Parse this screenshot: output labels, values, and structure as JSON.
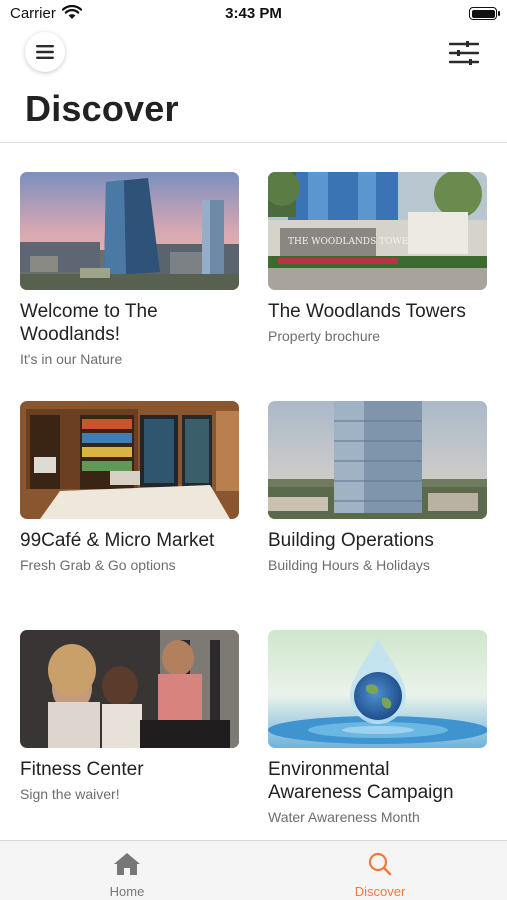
{
  "status_bar": {
    "carrier": "Carrier",
    "time": "3:43 PM"
  },
  "header": {
    "title": "Discover",
    "menu_icon": "hamburger-icon",
    "filter_icon": "sliders-icon"
  },
  "cards": [
    {
      "title": "Welcome to The Woodlands!",
      "subtitle": "It's in our Nature",
      "image": "city-skyline-photo"
    },
    {
      "title": "The Woodlands Towers",
      "subtitle": "Property brochure",
      "image": "towers-entrance-photo"
    },
    {
      "title": "99Café & Micro Market",
      "subtitle": "Fresh Grab & Go options",
      "image": "micro-market-photo"
    },
    {
      "title": "Building Operations",
      "subtitle": "Building Hours & Holidays",
      "image": "glass-tower-photo"
    },
    {
      "title": "Fitness Center",
      "subtitle": "Sign the waiver!",
      "image": "fitness-people-photo"
    },
    {
      "title": "Environmental Awareness Campaign",
      "subtitle": "Water Awareness Month",
      "image": "earth-water-drop-photo"
    }
  ],
  "tabs": [
    {
      "label": "Home",
      "icon": "home-icon",
      "active": false
    },
    {
      "label": "Discover",
      "icon": "search-icon",
      "active": true
    }
  ],
  "colors": {
    "accent": "#f2783f",
    "inactive_tab": "#777777",
    "subtitle": "#6d6d6d"
  }
}
